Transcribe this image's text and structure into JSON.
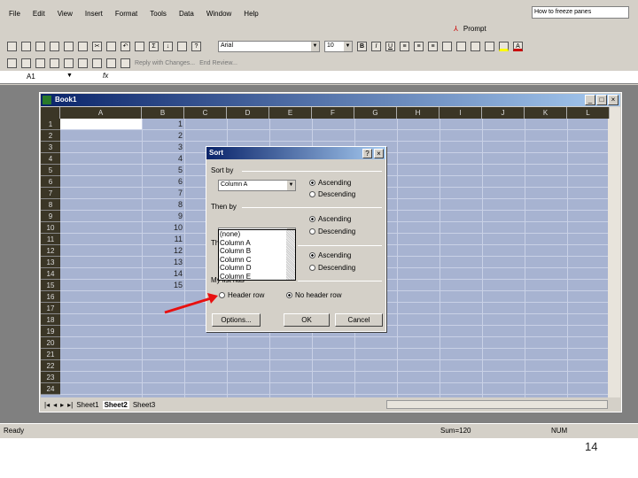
{
  "menu": [
    "File",
    "Edit",
    "View",
    "Insert",
    "Format",
    "Tools",
    "Data",
    "Window",
    "Help"
  ],
  "help_box": "How to freeze panes",
  "prompt_label": "Prompt",
  "font_name": "Arial",
  "font_size": "10",
  "review_label": "Reply with Changes...",
  "end_review": "End Review...",
  "name_box": "A1",
  "fx": "fx",
  "workbook_title": "Book1",
  "columns": [
    "A",
    "B",
    "C",
    "D",
    "E",
    "F",
    "G",
    "H",
    "I",
    "J",
    "K",
    "L"
  ],
  "rows": [
    "1",
    "2",
    "3",
    "4",
    "5",
    "6",
    "7",
    "8",
    "9",
    "10",
    "11",
    "12",
    "13",
    "14",
    "15",
    "16",
    "17",
    "18",
    "19",
    "20",
    "21",
    "22",
    "23",
    "24"
  ],
  "column_b_values": [
    "1",
    "2",
    "3",
    "4",
    "5",
    "6",
    "7",
    "8",
    "9",
    "10",
    "11",
    "12",
    "13",
    "14",
    "15"
  ],
  "sheet_tabs": [
    "Sheet1",
    "Sheet2",
    "Sheet3"
  ],
  "active_sheet": "Sheet2",
  "status": {
    "ready": "Ready",
    "sum": "Sum=120",
    "num": "NUM"
  },
  "dialog": {
    "title": "Sort",
    "sort_by": "Sort by",
    "sort_by_value": "Column A",
    "then_by": "Then by",
    "then_by_value": "",
    "then_by2": "Then by",
    "ascending": "Ascending",
    "descending": "Descending",
    "my_list_has": "My list has",
    "header_row": "Header row",
    "no_header_row": "No header row",
    "options": "Options...",
    "ok": "OK",
    "cancel": "Cancel",
    "dropdown_options": [
      "(none)",
      "Column A",
      "Column B",
      "Column C",
      "Column D",
      "Column E"
    ]
  },
  "page_number": "14",
  "colors": {
    "titlebar": "#0a246a",
    "selection": "#a7b3d1",
    "arrow": "#e81010"
  }
}
